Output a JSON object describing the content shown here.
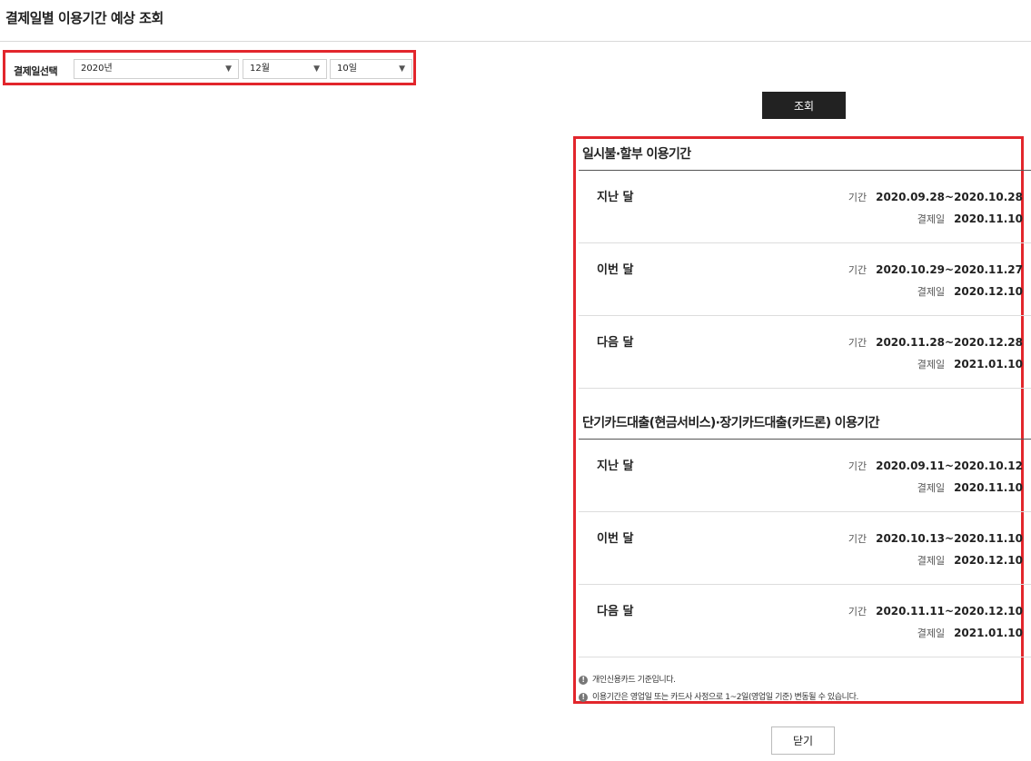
{
  "page": {
    "title": "결제일별 이용기간 예상 조회"
  },
  "select": {
    "label": "결제일선택",
    "year": "2020년",
    "month": "12월",
    "day": "10일",
    "arrow": "▼"
  },
  "search_button": "조회",
  "sections": [
    {
      "title": "일시불·할부 이용기간",
      "rows": [
        {
          "label": "지난 달",
          "period_label": "기간",
          "period": "2020.09.28~2020.10.28",
          "pay_label": "결제일",
          "pay_date": "2020.11.10"
        },
        {
          "label": "이번 달",
          "period_label": "기간",
          "period": "2020.10.29~2020.11.27",
          "pay_label": "결제일",
          "pay_date": "2020.12.10"
        },
        {
          "label": "다음 달",
          "period_label": "기간",
          "period": "2020.11.28~2020.12.28",
          "pay_label": "결제일",
          "pay_date": "2021.01.10"
        }
      ]
    },
    {
      "title": "단기카드대출(현금서비스)·장기카드대출(카드론) 이용기간",
      "rows": [
        {
          "label": "지난 달",
          "period_label": "기간",
          "period": "2020.09.11~2020.10.12",
          "pay_label": "결제일",
          "pay_date": "2020.11.10"
        },
        {
          "label": "이번 달",
          "period_label": "기간",
          "period": "2020.10.13~2020.11.10",
          "pay_label": "결제일",
          "pay_date": "2020.12.10"
        },
        {
          "label": "다음 달",
          "period_label": "기간",
          "period": "2020.11.11~2020.12.10",
          "pay_label": "결제일",
          "pay_date": "2021.01.10"
        }
      ]
    }
  ],
  "notes": [
    "개인신용카드 기준입니다.",
    "이용기간은 영업일 또는 카드사 사정으로 1~2일(영업일 기준) 변동될 수 있습니다."
  ],
  "note_icon": "!",
  "close_button": "닫기"
}
